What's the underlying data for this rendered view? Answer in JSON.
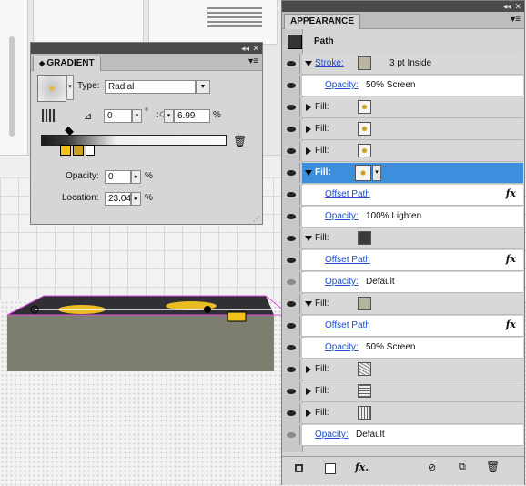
{
  "gradient_panel": {
    "tab_label": "GRADIENT",
    "type_label": "Type:",
    "type_value": "Radial",
    "angle_value": "0",
    "angle_unit": "°",
    "aspect_value": "6.99",
    "aspect_unit": "%",
    "opacity_label": "Opacity:",
    "opacity_value": "0",
    "opacity_unit": "%",
    "location_label": "Location:",
    "location_value": "23.04",
    "location_unit": "%"
  },
  "appearance_panel": {
    "tab_label": "APPEARANCE",
    "header_label": "Path",
    "rows": [
      {
        "kind": "Stroke:",
        "detail": "3 pt  Inside"
      },
      {
        "kind": "Opacity:",
        "detail": "50% Screen"
      },
      {
        "kind": "Fill:"
      },
      {
        "kind": "Fill:"
      },
      {
        "kind": "Fill:"
      },
      {
        "kind": "Fill:"
      },
      {
        "kind": "Offset Path"
      },
      {
        "kind": "Opacity:",
        "detail": "100% Lighten"
      },
      {
        "kind": "Fill:"
      },
      {
        "kind": "Offset Path"
      },
      {
        "kind": "Opacity:",
        "detail": "Default"
      },
      {
        "kind": "Fill:"
      },
      {
        "kind": "Offset Path"
      },
      {
        "kind": "Opacity:",
        "detail": "50% Screen"
      },
      {
        "kind": "Fill:"
      },
      {
        "kind": "Fill:"
      },
      {
        "kind": "Fill:"
      },
      {
        "kind": "Opacity:",
        "detail": "Default"
      }
    ],
    "fx_label": "fx"
  },
  "colors": {
    "selection": "#3c8fdc",
    "link": "#1a4fc9",
    "stroke_swatch": "#b9b6a6",
    "dark_fill": "#3a3a3c",
    "olive_fill": "#b3b5a0",
    "counter_top": "#2f2f35",
    "counter_side": "#7d7e70"
  }
}
